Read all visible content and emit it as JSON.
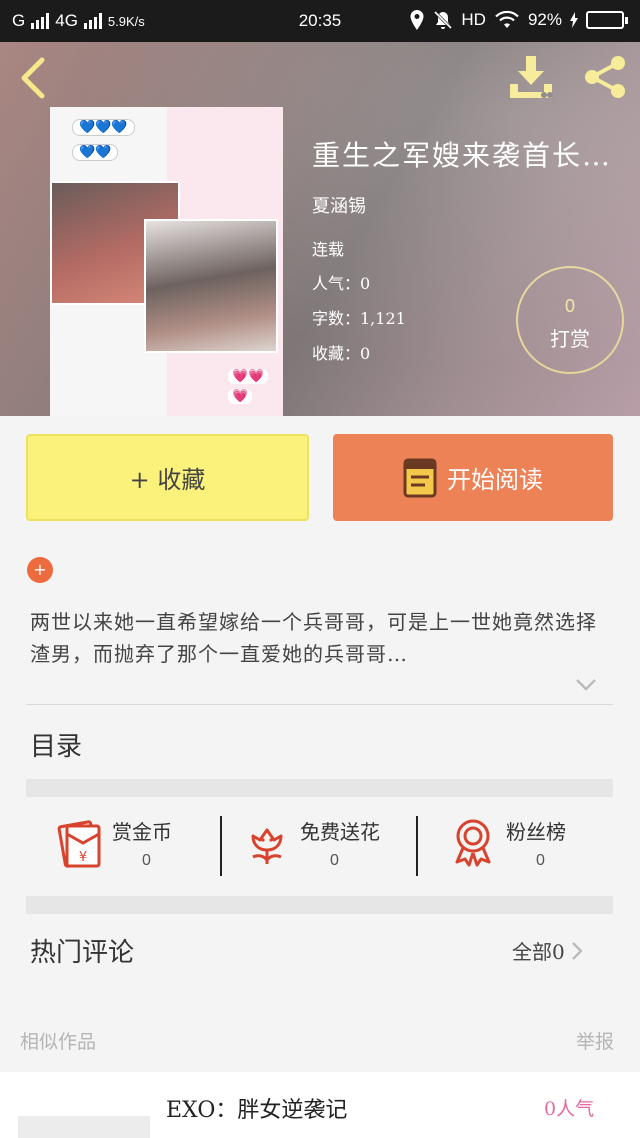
{
  "status_bar": {
    "carrier": "G",
    "network": "4G",
    "speed": "5.9K/s",
    "time": "20:35",
    "hd": "HD",
    "battery": "92%",
    "battery_level": 0.92
  },
  "book": {
    "title": "重生之军嫂来袭首长…",
    "author": "夏涵锡",
    "status": "连载",
    "popularity_label": "人气：0",
    "word_count_label": "字数：1,121",
    "favorites_label": "收藏：0",
    "tip_count": "0",
    "tip_label": "打赏",
    "cover_bubbles": [
      "💙💙💙",
      "💙💙"
    ],
    "cover_hearts": [
      "💗💗",
      "💗"
    ]
  },
  "actions": {
    "collect_label": "+ 收藏",
    "read_label": "开始阅读"
  },
  "summary": {
    "add_symbol": "+",
    "text": "两世以来她一直希望嫁给一个兵哥哥，可是上一世她竟然选择渣男，而抛弃了那个一直爱她的兵哥哥…"
  },
  "toc": {
    "title": "目录"
  },
  "stats": [
    {
      "label": "赏金币",
      "value": "0",
      "icon": "red-envelope-icon"
    },
    {
      "label": "免费送花",
      "value": "0",
      "icon": "flower-icon"
    },
    {
      "label": "粉丝榜",
      "value": "0",
      "icon": "award-medal-icon"
    }
  ],
  "comments": {
    "title": "热门评论",
    "all_label": "全部0"
  },
  "similar": {
    "title": "相似作品",
    "report_label": "举报",
    "items": [
      {
        "title": "EXO：胖女逆袭记",
        "popularity": "0人气"
      }
    ]
  },
  "colors": {
    "collect_button": "#fbf27c",
    "read_button": "#ee8257",
    "accent_orange": "#ee6a3f",
    "icon_red": "#d8432e",
    "header_icon_yellow": "#f6e98a",
    "popularity_pink": "#e36aa0"
  }
}
